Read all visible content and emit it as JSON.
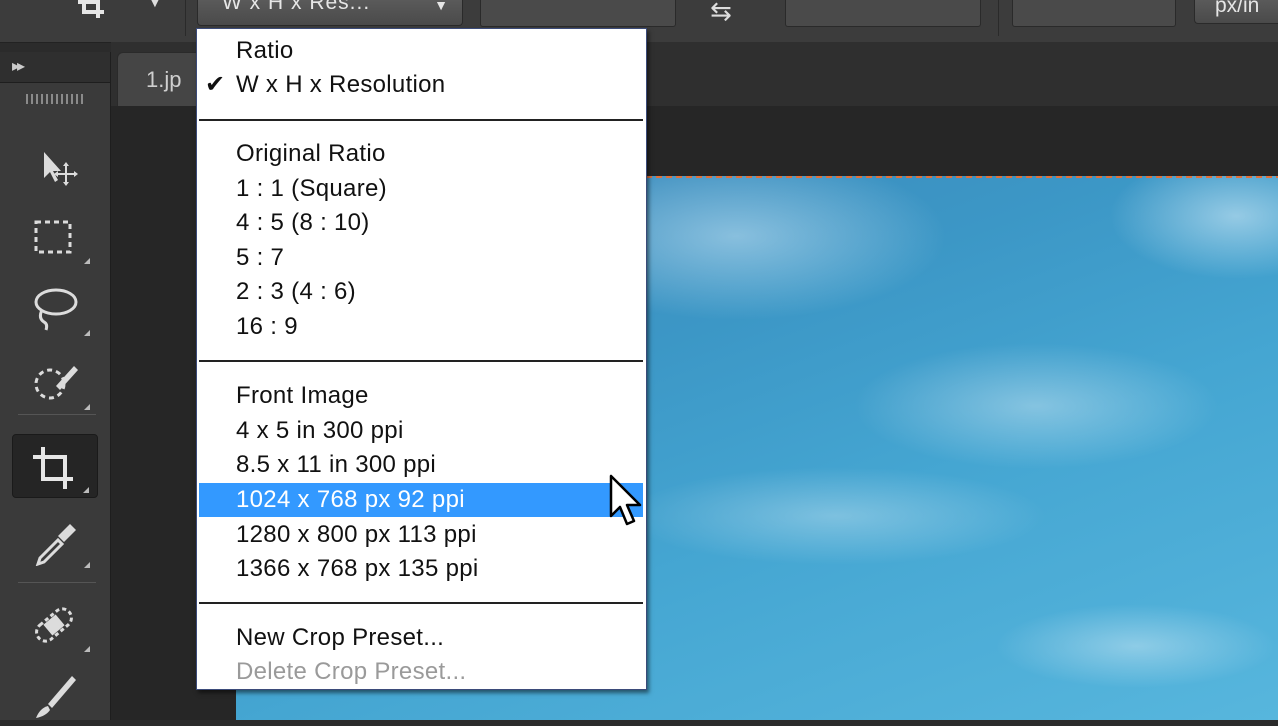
{
  "options_bar": {
    "aspect_select": "W x H x Res...",
    "units": "px/in"
  },
  "document": {
    "tab_title": "1.jp"
  },
  "crop_menu": {
    "groups": [
      {
        "items": [
          {
            "label": "Ratio",
            "checked": false
          },
          {
            "label": "W x H x Resolution",
            "checked": true
          }
        ]
      },
      {
        "items": [
          {
            "label": "Original Ratio"
          },
          {
            "label": "1 : 1 (Square)"
          },
          {
            "label": "4 : 5 (8 : 10)"
          },
          {
            "label": "5 : 7"
          },
          {
            "label": "2 : 3 (4 : 6)"
          },
          {
            "label": "16 : 9"
          }
        ]
      },
      {
        "items": [
          {
            "label": "Front Image"
          },
          {
            "label": "4 x 5 in 300 ppi"
          },
          {
            "label": "8.5 x 11 in 300 ppi"
          },
          {
            "label": "1024 x 768 px 92 ppi",
            "highlighted": true
          },
          {
            "label": "1280 x 800 px 113 ppi"
          },
          {
            "label": "1366 x 768 px 135 ppi"
          }
        ]
      },
      {
        "items": [
          {
            "label": "New Crop Preset..."
          },
          {
            "label": "Delete Crop Preset...",
            "disabled": true
          }
        ]
      }
    ],
    "check_glyph": "✔"
  },
  "colors": {
    "highlight": "#3399ff",
    "crop_guide": "#e0703a"
  },
  "icons": [
    "crop-tool-preset-icon",
    "swap-arrow-icon",
    "move-tool-icon",
    "marquee-tool-icon",
    "lasso-tool-icon",
    "quick-selection-icon",
    "crop-tool-icon",
    "eyedropper-icon",
    "healing-brush-icon",
    "brush-icon",
    "mouse-cursor-icon"
  ]
}
